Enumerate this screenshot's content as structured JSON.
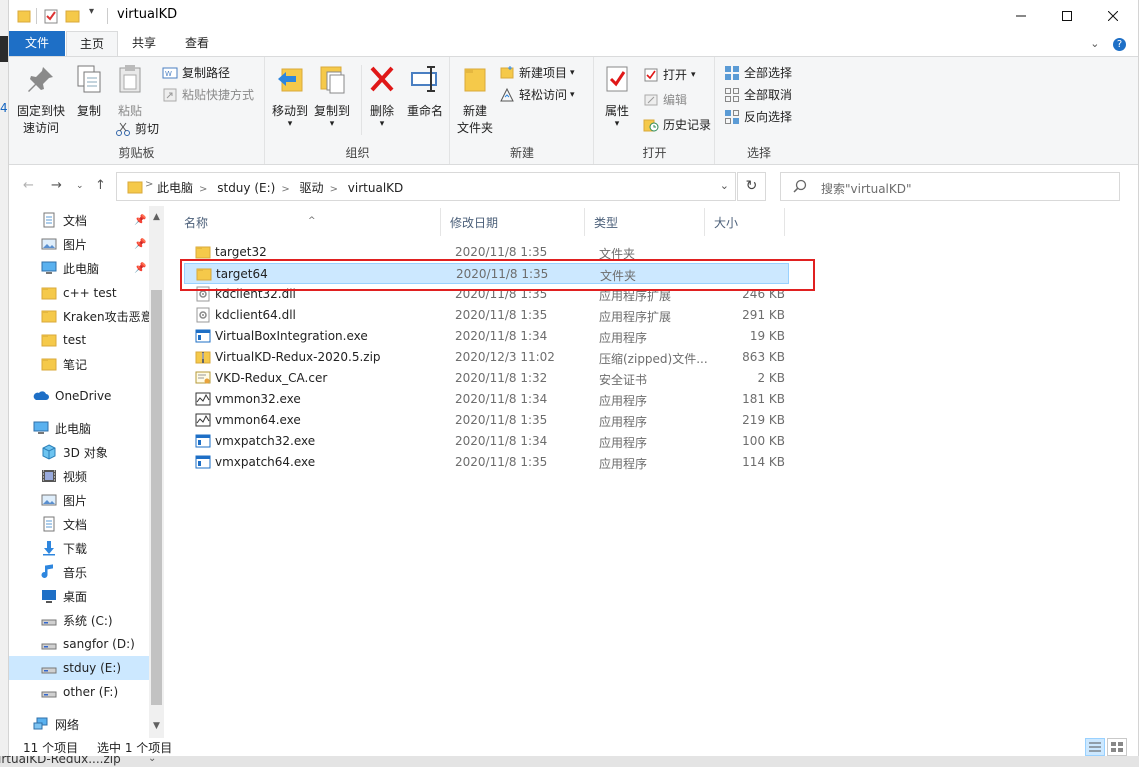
{
  "window": {
    "title": "virtualKD"
  },
  "tabs": [
    {
      "label": "文件"
    },
    {
      "label": "主页"
    },
    {
      "label": "共享"
    },
    {
      "label": "查看"
    }
  ],
  "ribbon": {
    "clipboard": {
      "label": "剪贴板",
      "pin_label_1": "固定到快",
      "pin_label_2": "速访问",
      "copy_label": "复制",
      "paste_label": "粘贴",
      "copy_path": "复制路径",
      "paste_shortcut": "粘贴快捷方式",
      "cut": "剪切"
    },
    "organize": {
      "label": "组织",
      "move_to": "移动到",
      "copy_to": "复制到",
      "delete": "删除",
      "rename": "重命名"
    },
    "new": {
      "label": "新建",
      "new_folder_1": "新建",
      "new_folder_2": "文件夹",
      "new_item": "新建项目",
      "easy_access": "轻松访问"
    },
    "open": {
      "label": "打开",
      "properties": "属性",
      "open": "打开",
      "edit": "编辑",
      "history": "历史记录"
    },
    "select": {
      "label": "选择",
      "select_all": "全部选择",
      "select_none": "全部取消",
      "invert": "反向选择"
    }
  },
  "address": {
    "crumbs": [
      "此电脑",
      "stduy (E:)",
      "驱动",
      "virtualKD"
    ],
    "separator": ">"
  },
  "search": {
    "placeholder": "搜索\"virtualKD\""
  },
  "nav_pane": {
    "quick_access": [
      {
        "label": "文档",
        "icon": "document-icon",
        "pinned": true
      },
      {
        "label": "图片",
        "icon": "picture-icon",
        "pinned": true
      },
      {
        "label": "此电脑",
        "icon": "computer-icon",
        "pinned": true
      },
      {
        "label": "c++ test",
        "icon": "folder-icon",
        "pinned": false
      },
      {
        "label": "Kraken攻击恶意",
        "icon": "folder-icon",
        "pinned": false
      },
      {
        "label": "test",
        "icon": "folder-icon",
        "pinned": false
      },
      {
        "label": "笔记",
        "icon": "folder-icon",
        "pinned": false
      }
    ],
    "onedrive": "OneDrive",
    "this_pc": "此电脑",
    "pc_items": [
      {
        "label": "3D 对象",
        "icon": "cube-icon"
      },
      {
        "label": "视频",
        "icon": "video-icon"
      },
      {
        "label": "图片",
        "icon": "picture-icon"
      },
      {
        "label": "文档",
        "icon": "document-icon"
      },
      {
        "label": "下载",
        "icon": "download-icon"
      },
      {
        "label": "音乐",
        "icon": "music-icon"
      },
      {
        "label": "桌面",
        "icon": "desktop-icon"
      },
      {
        "label": "系统 (C:)",
        "icon": "drive-icon"
      },
      {
        "label": "sangfor (D:)",
        "icon": "drive-icon"
      },
      {
        "label": "stduy (E:)",
        "icon": "drive-icon"
      },
      {
        "label": "other (F:)",
        "icon": "drive-icon"
      }
    ],
    "network": "网络"
  },
  "columns": {
    "name": "名称",
    "date": "修改日期",
    "type": "类型",
    "size": "大小"
  },
  "files": [
    {
      "name": "target32",
      "date": "2020/11/8 1:35",
      "type": "文件夹",
      "size": "",
      "icon": "folder-icon"
    },
    {
      "name": "target64",
      "date": "2020/11/8 1:35",
      "type": "文件夹",
      "size": "",
      "icon": "folder-icon"
    },
    {
      "name": "kdclient32.dll",
      "date": "2020/11/8 1:35",
      "type": "应用程序扩展",
      "size": "246 KB",
      "icon": "dll-icon"
    },
    {
      "name": "kdclient64.dll",
      "date": "2020/11/8 1:35",
      "type": "应用程序扩展",
      "size": "291 KB",
      "icon": "dll-icon"
    },
    {
      "name": "VirtualBoxIntegration.exe",
      "date": "2020/11/8 1:34",
      "type": "应用程序",
      "size": "19 KB",
      "icon": "exe-icon"
    },
    {
      "name": "VirtualKD-Redux-2020.5.zip",
      "date": "2020/12/3 11:02",
      "type": "压缩(zipped)文件...",
      "size": "863 KB",
      "icon": "zip-icon"
    },
    {
      "name": "VKD-Redux_CA.cer",
      "date": "2020/11/8 1:32",
      "type": "安全证书",
      "size": "2 KB",
      "icon": "certificate-icon"
    },
    {
      "name": "vmmon32.exe",
      "date": "2020/11/8 1:34",
      "type": "应用程序",
      "size": "181 KB",
      "icon": "monitor-exe-icon"
    },
    {
      "name": "vmmon64.exe",
      "date": "2020/11/8 1:35",
      "type": "应用程序",
      "size": "219 KB",
      "icon": "monitor-exe-icon"
    },
    {
      "name": "vmxpatch32.exe",
      "date": "2020/11/8 1:34",
      "type": "应用程序",
      "size": "100 KB",
      "icon": "exe-icon"
    },
    {
      "name": "vmxpatch64.exe",
      "date": "2020/11/8 1:35",
      "type": "应用程序",
      "size": "114 KB",
      "icon": "exe-icon"
    }
  ],
  "status": {
    "count": "11 个项目",
    "selected": "选中 1 个项目"
  },
  "taskbar": {
    "item": "irtualKD-Redux....zip"
  },
  "background": {
    "left_digit": "4"
  },
  "colors": {
    "accent": "#1e6fc6",
    "selection": "#cce8ff",
    "highlight_box": "#e02020",
    "folder": "#f5c94a"
  }
}
